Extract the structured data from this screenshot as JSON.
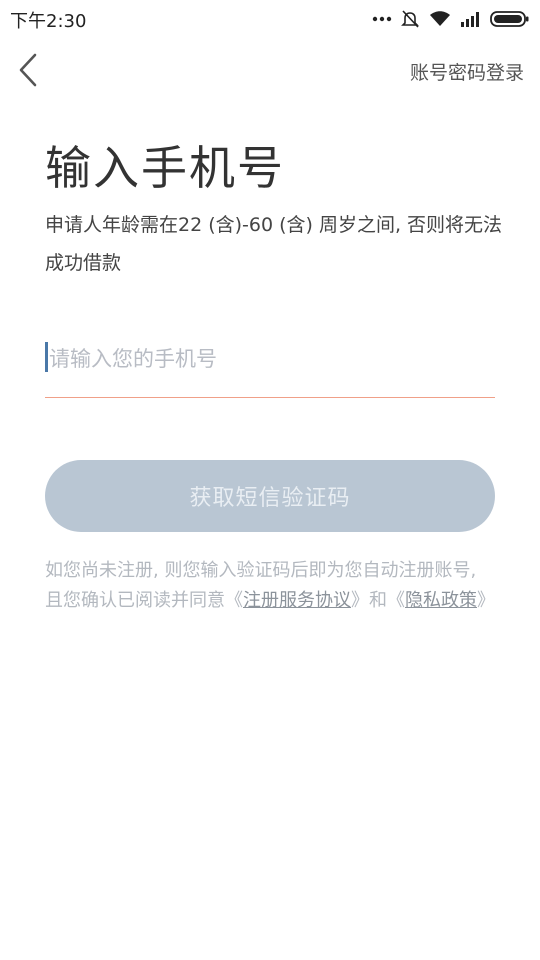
{
  "status_bar": {
    "time": "下午2:30",
    "icons": [
      "more-dots-icon",
      "mute-bell-icon",
      "wifi-icon",
      "signal-icon",
      "battery-icon"
    ]
  },
  "nav": {
    "back_icon": "chevron-left-icon",
    "account_login_label": "账号密码登录"
  },
  "header": {
    "title": "输入手机号",
    "subtitle": "申请人年龄需在22 (含)-60 (含) 周岁之间, 否则将无法成功借款"
  },
  "phone_input": {
    "value": "",
    "placeholder": "请输入您的手机号"
  },
  "sms_button": {
    "label": "获取短信验证码"
  },
  "notice": {
    "prefix": "如您尚未注册, 则您输入验证码后即为您自动注册账号, 且您确认已阅读并同意《",
    "service_agreement": "注册服务协议",
    "middle": "》和《",
    "privacy_policy": "隐私政策",
    "suffix": "》"
  },
  "colors": {
    "button_disabled_bg": "#b9c6d3",
    "input_underline": "#f0a088",
    "caret": "#4a78a8"
  }
}
